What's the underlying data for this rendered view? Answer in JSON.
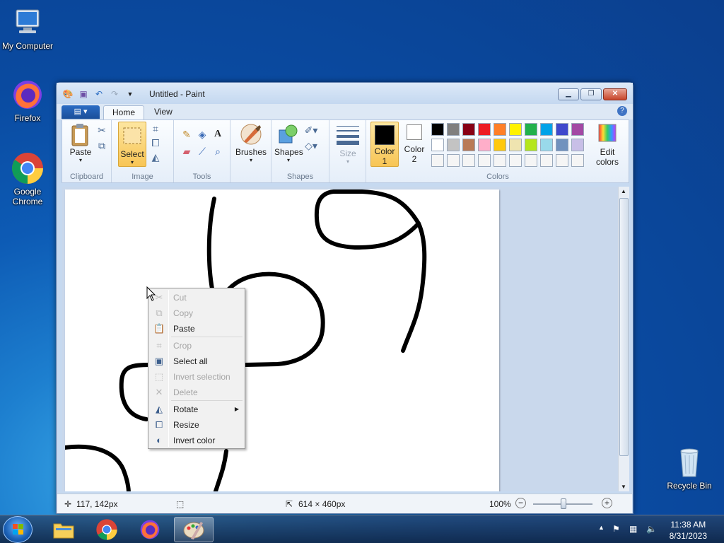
{
  "desktop": {
    "icons": [
      {
        "label": "My Computer",
        "icon": "computer-icon"
      },
      {
        "label": "Firefox",
        "icon": "firefox-icon"
      },
      {
        "label": "Google\nChrome",
        "line1": "Google",
        "line2": "Chrome",
        "icon": "chrome-icon"
      },
      {
        "label": "Recycle Bin",
        "icon": "recycle-bin-icon"
      }
    ]
  },
  "window": {
    "title": "Untitled - Paint",
    "tabs": [
      "Home",
      "View"
    ],
    "file_menu_icon": "file-menu-icon"
  },
  "ribbon": {
    "clipboard": {
      "label": "Clipboard",
      "paste": "Paste"
    },
    "image": {
      "label": "Image",
      "select": "Select"
    },
    "tools": {
      "label": "Tools"
    },
    "brushes": {
      "label": "Brushes"
    },
    "shapes": {
      "label": "Shapes",
      "button": "Shapes"
    },
    "size": {
      "label": "Size"
    },
    "colors": {
      "label": "Colors",
      "color1_line1": "Color",
      "color1_line2": "1",
      "color2_line1": "Color",
      "color2_line2": "2",
      "edit_line1": "Edit",
      "edit_line2": "colors",
      "color1_value": "#000000",
      "color2_value": "#ffffff",
      "palette_row1": [
        "#000000",
        "#7f7f7f",
        "#880015",
        "#ed1c24",
        "#ff7f27",
        "#fff200",
        "#22b14c",
        "#00a2e8",
        "#3f48cc",
        "#a349a4"
      ],
      "palette_row2": [
        "#ffffff",
        "#c3c3c3",
        "#b97a57",
        "#ffaec9",
        "#ffc90e",
        "#efe4b0",
        "#b5e61d",
        "#99d9ea",
        "#7092be",
        "#c8bfe7"
      ],
      "palette_row3": [
        "#f5f5f5",
        "#f5f5f5",
        "#f5f5f5",
        "#f5f5f5",
        "#f5f5f5",
        "#f5f5f5",
        "#f5f5f5",
        "#f5f5f5",
        "#f5f5f5",
        "#f5f5f5"
      ]
    }
  },
  "context_menu": {
    "items": [
      {
        "label": "Cut",
        "enabled": false,
        "icon": "scissors-icon"
      },
      {
        "label": "Copy",
        "enabled": false,
        "icon": "copy-icon"
      },
      {
        "label": "Paste",
        "enabled": true,
        "icon": "clipboard-icon"
      },
      {
        "label": "Crop",
        "enabled": false,
        "icon": "crop-icon"
      },
      {
        "label": "Select all",
        "enabled": true,
        "icon": "select-all-icon"
      },
      {
        "label": "Invert selection",
        "enabled": false,
        "icon": "invert-selection-icon"
      },
      {
        "label": "Delete",
        "enabled": false,
        "icon": "delete-icon"
      },
      {
        "label": "Rotate",
        "enabled": true,
        "icon": "rotate-icon",
        "submenu": true
      },
      {
        "label": "Resize",
        "enabled": true,
        "icon": "resize-icon"
      },
      {
        "label": "Invert color",
        "enabled": true,
        "icon": "invert-color-icon"
      }
    ]
  },
  "status": {
    "cursor_position": "117, 142px",
    "image_size": "614 × 460px",
    "zoom": "100%"
  },
  "taskbar": {
    "time": "11:38 AM",
    "date": "8/31/2023"
  }
}
